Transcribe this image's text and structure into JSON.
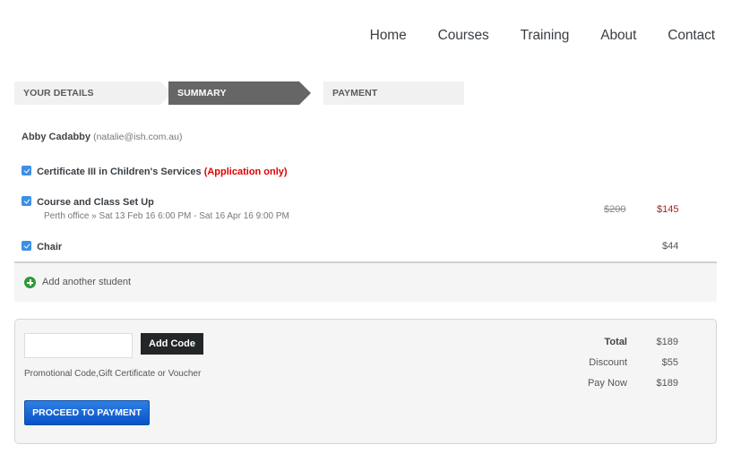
{
  "nav": {
    "items": [
      "Home",
      "Courses",
      "Training",
      "About",
      "Contact"
    ]
  },
  "steps": [
    {
      "label": "YOUR DETAILS",
      "active": false
    },
    {
      "label": "SUMMARY",
      "active": true
    },
    {
      "label": "PAYMENT",
      "active": false
    }
  ],
  "student": {
    "name": "Abby Cadabby",
    "email": "(natalie@ish.com.au)"
  },
  "items": [
    {
      "title": "Certificate III in Children's Services",
      "note": "(Application only)",
      "checked": true
    },
    {
      "title": "Course and Class Set Up",
      "subtitle": "Perth office » Sat 13 Feb 16 6:00 PM - Sat 16 Apr 16 9:00 PM",
      "old_price": "$200",
      "price": "$145",
      "checked": true
    },
    {
      "title": "Chair",
      "price": "$44",
      "checked": true
    }
  ],
  "add_student": {
    "icon": "plus-circle-icon",
    "label": "Add another student"
  },
  "promo": {
    "input_value": "",
    "input_placeholder": "",
    "button_label": "Add Code",
    "description": "Promotional Code,Gift Certificate or Voucher"
  },
  "proceed_label": "PROCEED TO PAYMENT",
  "totals": [
    {
      "label": "Total",
      "value": "$189"
    },
    {
      "label": "Discount",
      "value": "$55"
    },
    {
      "label": "Pay Now",
      "value": "$189"
    }
  ],
  "colors": {
    "accent_blue": "#0a52c8",
    "active_step": "#666666",
    "discount_price": "#a52020",
    "application_note": "#e00000",
    "add_icon": "#2e9a35"
  }
}
